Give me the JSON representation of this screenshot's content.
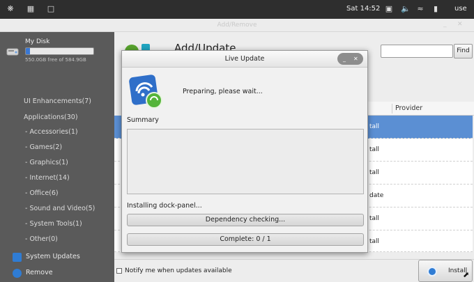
{
  "system_bar": {
    "clock": "Sat 14:52",
    "user": "use",
    "icons": [
      "apps-icon",
      "grid-icon",
      "window-icon",
      "screenshot-icon",
      "volume-icon",
      "wifi-icon",
      "battery-icon"
    ]
  },
  "app_window": {
    "title": "Add/Remove",
    "controls": [
      "minimize-icon",
      "close-icon"
    ]
  },
  "sidebar": {
    "disk": {
      "name": "My Disk",
      "free_text": "550.0GB free of 584.9GB",
      "used_fraction": 0.06
    },
    "categories": [
      {
        "label": "UI Enhancements(7)"
      },
      {
        "label": "Applications(30)"
      }
    ],
    "subcategories": [
      {
        "label": "- Accessories(1)"
      },
      {
        "label": "- Games(2)"
      },
      {
        "label": "- Graphics(1)"
      },
      {
        "label": "- Internet(14)"
      },
      {
        "label": "- Office(6)"
      },
      {
        "label": "- Sound and Video(5)"
      },
      {
        "label": "- System Tools(1)"
      },
      {
        "label": "- Other(0)"
      }
    ],
    "system_updates": "System Updates",
    "remove": "Remove"
  },
  "main": {
    "title": "Add/Update",
    "search_placeholder": "",
    "find_label": "Find",
    "table_header_provider": "Provider",
    "rows": [
      {
        "status": "tall",
        "selected": true
      },
      {
        "status": "tall",
        "selected": false
      },
      {
        "status": "tall",
        "selected": false
      },
      {
        "status": "date",
        "selected": false
      },
      {
        "status": "tall",
        "selected": false
      },
      {
        "status": "tall",
        "selected": false
      }
    ],
    "notify_label": "Notify me when updates available",
    "install_label": "Install"
  },
  "dialog": {
    "title": "Live Update",
    "message": "Preparing, please wait...",
    "summary_label": "Summary",
    "status_text": "Installing dock-panel...",
    "progress1_text": "Dependency checking...",
    "progress1_fraction": 0,
    "progress2_text": "Complete: 0 / 1",
    "progress2_fraction": 0
  },
  "colors": {
    "selection": "#5b8fd3",
    "sidebar_bg": "#5a5a5a",
    "topbar_bg": "#2e2e2e"
  }
}
